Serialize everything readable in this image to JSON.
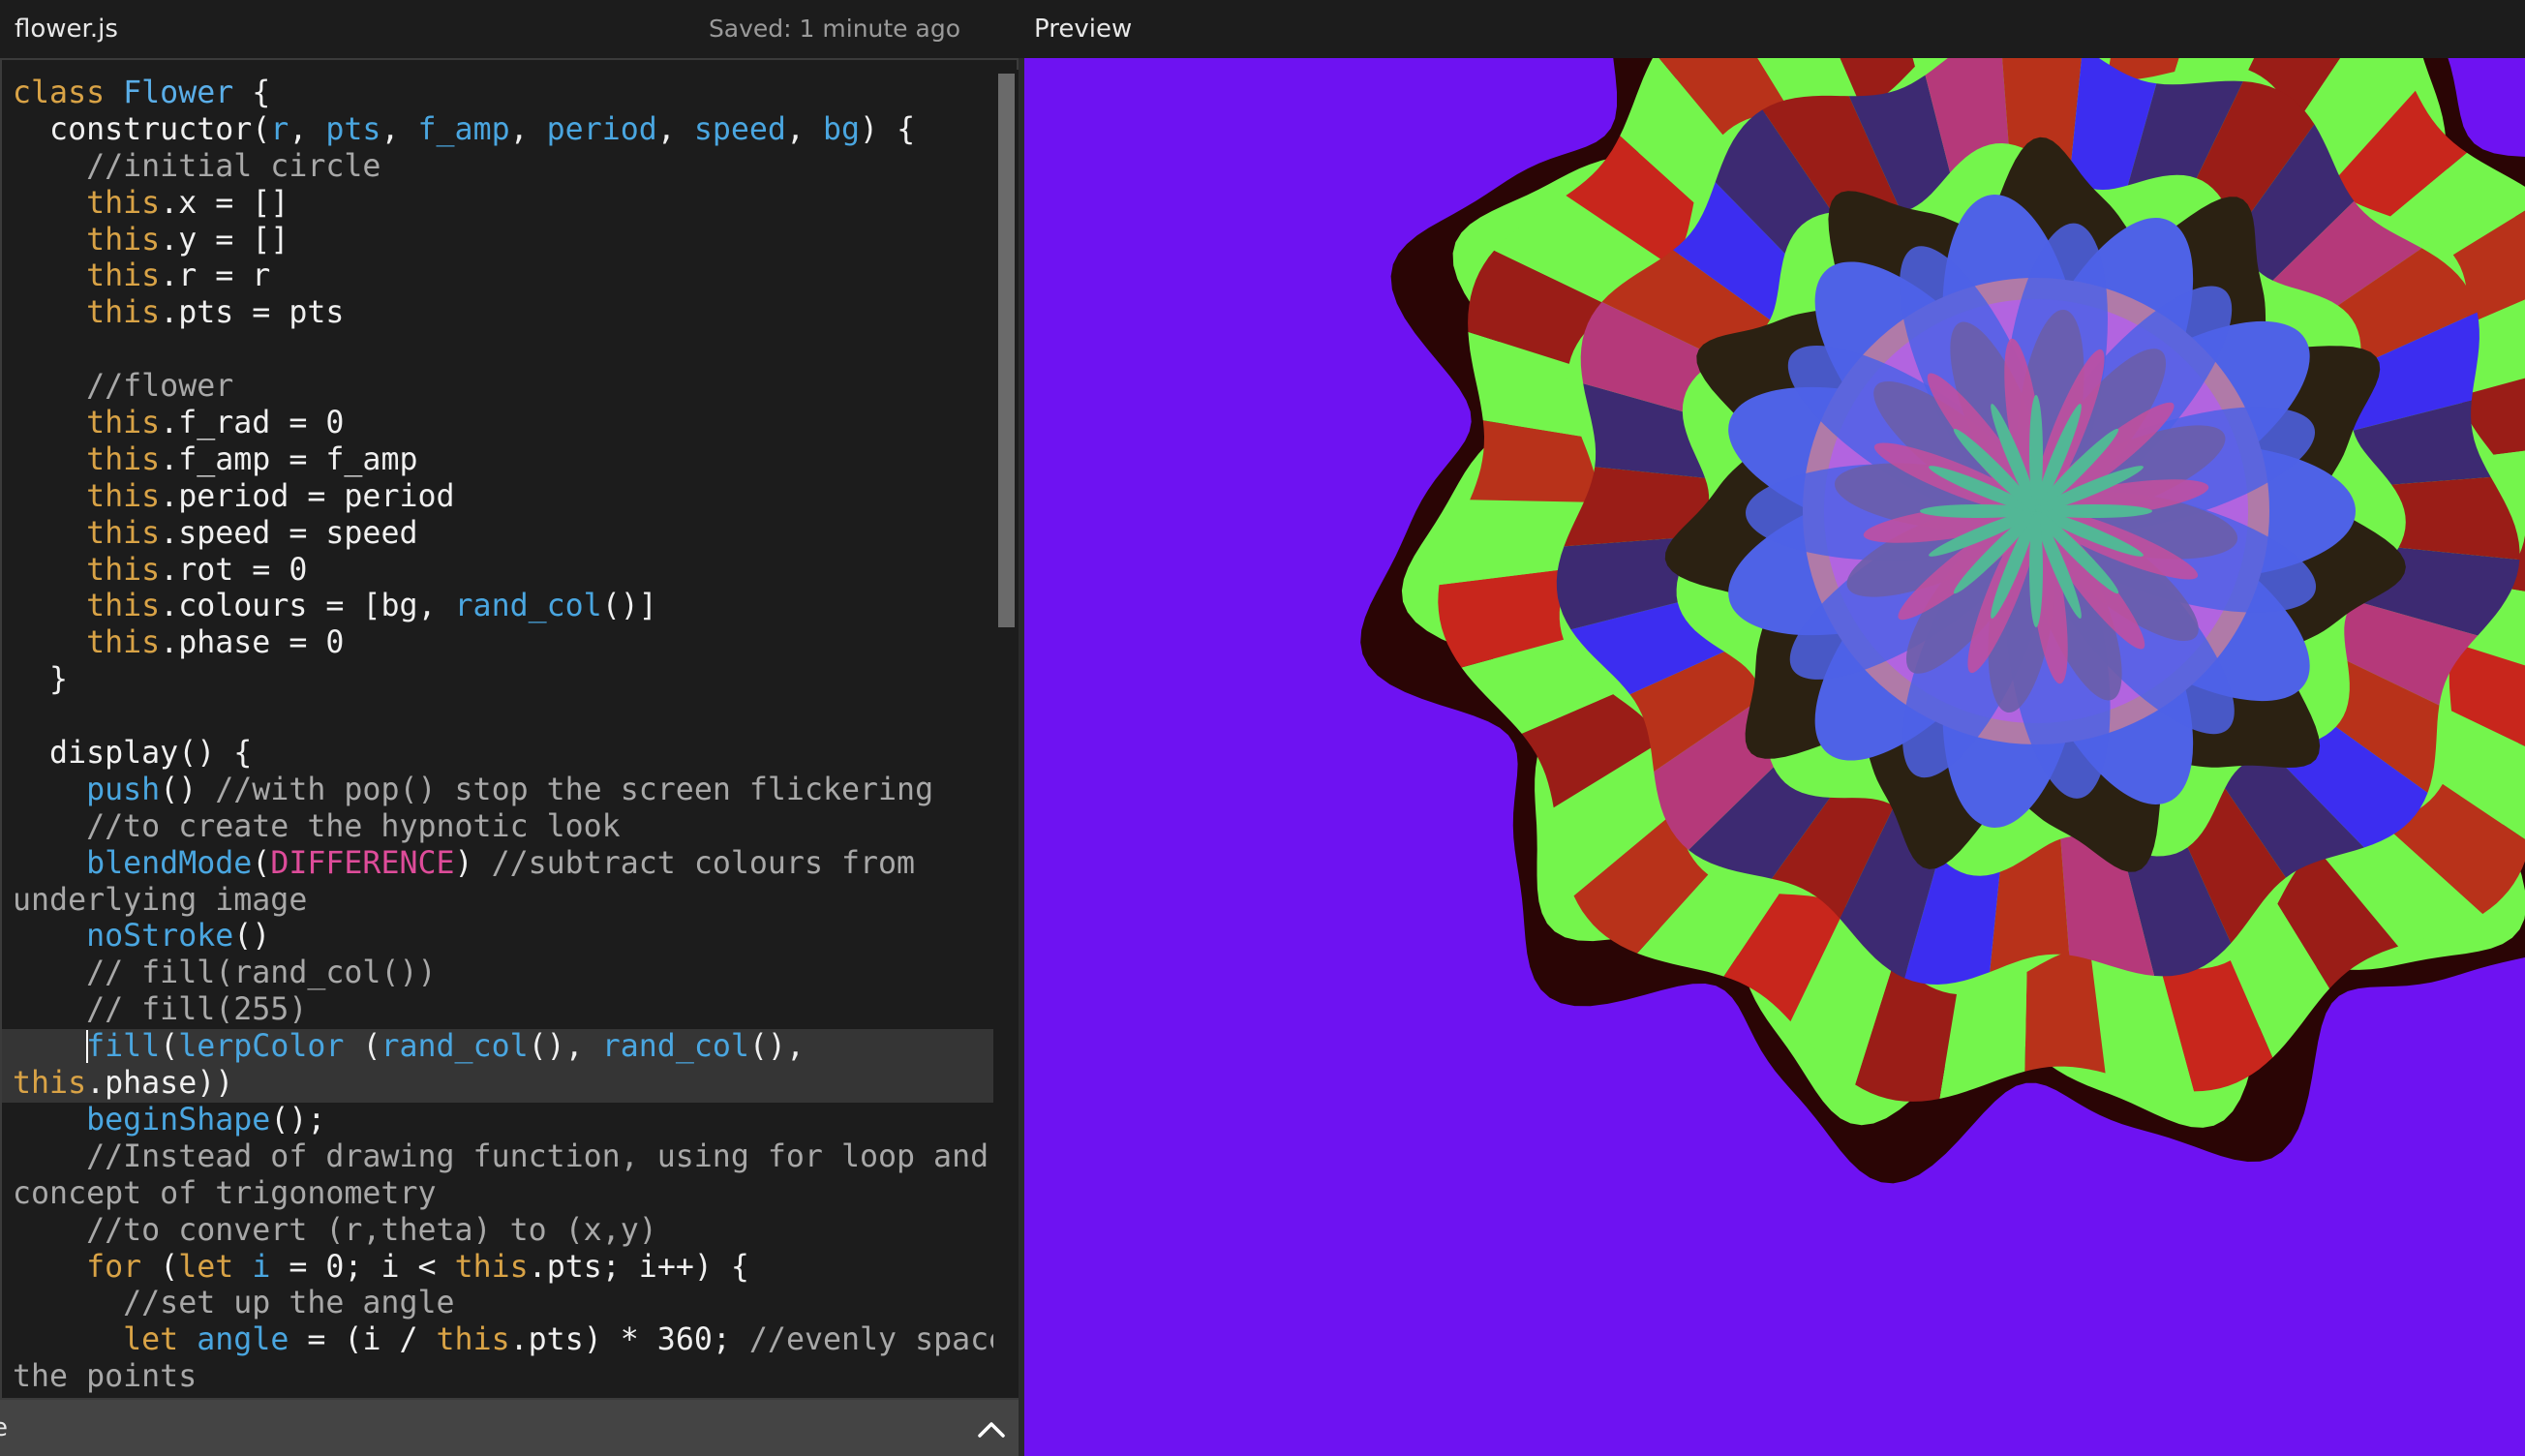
{
  "editor": {
    "file_name": "flower.js",
    "saved_status": "Saved: 1 minute ago"
  },
  "preview": {
    "label": "Preview",
    "canvas_colors": {
      "background": "#6e12f2",
      "outer_blob": "#2a0505",
      "green": "#74f54c",
      "red": "#9a1d17",
      "bright_red": "#c8261c",
      "orange_red": "#b8321a",
      "navy": "#3d2a72",
      "blue": "#3c2df0",
      "magenta": "#b5397a",
      "dark": "#2b2112",
      "royal_blue": "#4e62e6",
      "lilac": "#b264e0",
      "mauve": "#b07aa8",
      "slate": "#6a5eaa",
      "teal": "#52b796",
      "pink": "#c44f9e"
    }
  },
  "console": {
    "label": "e",
    "toggle_icon": "chevron-up-icon"
  },
  "code": {
    "lines": [
      [
        [
          "kw",
          "class "
        ],
        [
          "cls",
          "Flower"
        ],
        [
          "p",
          " {"
        ]
      ],
      [
        [
          "p",
          "  constructor("
        ],
        [
          "prm",
          "r"
        ],
        [
          "p",
          ", "
        ],
        [
          "prm",
          "pts"
        ],
        [
          "p",
          ", "
        ],
        [
          "prm",
          "f_amp"
        ],
        [
          "p",
          ", "
        ],
        [
          "prm",
          "period"
        ],
        [
          "p",
          ", "
        ],
        [
          "prm",
          "speed"
        ],
        [
          "p",
          ", "
        ],
        [
          "prm",
          "bg"
        ],
        [
          "p",
          ") {"
        ]
      ],
      [
        [
          "cm",
          "    //initial circle"
        ]
      ],
      [
        [
          "p",
          "    "
        ],
        [
          "kw",
          "this"
        ],
        [
          "p",
          ".x = []"
        ]
      ],
      [
        [
          "p",
          "    "
        ],
        [
          "kw",
          "this"
        ],
        [
          "p",
          ".y = []"
        ]
      ],
      [
        [
          "p",
          "    "
        ],
        [
          "kw",
          "this"
        ],
        [
          "p",
          ".r = r"
        ]
      ],
      [
        [
          "p",
          "    "
        ],
        [
          "kw",
          "this"
        ],
        [
          "p",
          ".pts = pts"
        ]
      ],
      [
        [
          "p",
          ""
        ]
      ],
      [
        [
          "cm",
          "    //flower"
        ]
      ],
      [
        [
          "p",
          "    "
        ],
        [
          "kw",
          "this"
        ],
        [
          "p",
          ".f_rad = 0"
        ]
      ],
      [
        [
          "p",
          "    "
        ],
        [
          "kw",
          "this"
        ],
        [
          "p",
          ".f_amp = f_amp"
        ]
      ],
      [
        [
          "p",
          "    "
        ],
        [
          "kw",
          "this"
        ],
        [
          "p",
          ".period = period"
        ]
      ],
      [
        [
          "p",
          "    "
        ],
        [
          "kw",
          "this"
        ],
        [
          "p",
          ".speed = speed"
        ]
      ],
      [
        [
          "p",
          "    "
        ],
        [
          "kw",
          "this"
        ],
        [
          "p",
          ".rot = 0"
        ]
      ],
      [
        [
          "p",
          "    "
        ],
        [
          "kw",
          "this"
        ],
        [
          "p",
          ".colours = [bg, "
        ],
        [
          "fn",
          "rand_col"
        ],
        [
          "p",
          "()]"
        ]
      ],
      [
        [
          "p",
          "    "
        ],
        [
          "kw",
          "this"
        ],
        [
          "p",
          ".phase = 0"
        ]
      ],
      [
        [
          "p",
          "  }"
        ]
      ],
      [
        [
          "p",
          ""
        ]
      ],
      [
        [
          "p",
          "  display() {"
        ]
      ],
      [
        [
          "p",
          "    "
        ],
        [
          "fn",
          "push"
        ],
        [
          "p",
          "() "
        ],
        [
          "cm",
          "//with pop() stop the screen flickering"
        ]
      ],
      [
        [
          "cm",
          "    //to create the hypnotic look"
        ]
      ],
      [
        [
          "p",
          "    "
        ],
        [
          "fn",
          "blendMode"
        ],
        [
          "p",
          "("
        ],
        [
          "const",
          "DIFFERENCE"
        ],
        [
          "p",
          ") "
        ],
        [
          "cm",
          "//subtract colours from"
        ]
      ],
      [
        [
          "cm",
          "underlying image"
        ]
      ],
      [
        [
          "p",
          "    "
        ],
        [
          "fn",
          "noStroke"
        ],
        [
          "p",
          "()"
        ]
      ],
      [
        [
          "cm",
          "    // fill(rand_col())"
        ]
      ],
      [
        [
          "cm",
          "    // fill(255)"
        ]
      ],
      [
        [
          "p",
          "    "
        ],
        [
          "cursor",
          ""
        ],
        [
          "fn",
          "fill"
        ],
        [
          "p",
          "("
        ],
        [
          "fn",
          "lerpColor"
        ],
        [
          "p",
          " ("
        ],
        [
          "fn",
          "rand_col"
        ],
        [
          "p",
          "(), "
        ],
        [
          "fn",
          "rand_col"
        ],
        [
          "p",
          "(),"
        ]
      ],
      [
        [
          "kw",
          "this"
        ],
        [
          "p",
          ".phase))"
        ]
      ],
      [
        [
          "p",
          "    "
        ],
        [
          "fn",
          "beginShape"
        ],
        [
          "p",
          "();"
        ]
      ],
      [
        [
          "cm",
          "    //Instead of drawing function, using for loop and"
        ]
      ],
      [
        [
          "cm",
          "concept of trigonometry"
        ]
      ],
      [
        [
          "cm",
          "    //to convert (r,theta) to (x,y)"
        ]
      ],
      [
        [
          "p",
          "    "
        ],
        [
          "kw",
          "for"
        ],
        [
          "p",
          " ("
        ],
        [
          "kw",
          "let"
        ],
        [
          "p",
          " "
        ],
        [
          "prm",
          "i"
        ],
        [
          "p",
          " = 0; i < "
        ],
        [
          "kw",
          "this"
        ],
        [
          "p",
          ".pts; i++) {"
        ]
      ],
      [
        [
          "cm",
          "      //set up the angle"
        ]
      ],
      [
        [
          "p",
          "      "
        ],
        [
          "kw",
          "let"
        ],
        [
          "p",
          " "
        ],
        [
          "prm",
          "angle"
        ],
        [
          "p",
          " = (i / "
        ],
        [
          "kw",
          "this"
        ],
        [
          "p",
          ".pts) * 360; "
        ],
        [
          "cm",
          "//evenly space"
        ]
      ],
      [
        [
          "cm",
          "the points"
        ]
      ]
    ],
    "active_lines": [
      26,
      27
    ]
  }
}
